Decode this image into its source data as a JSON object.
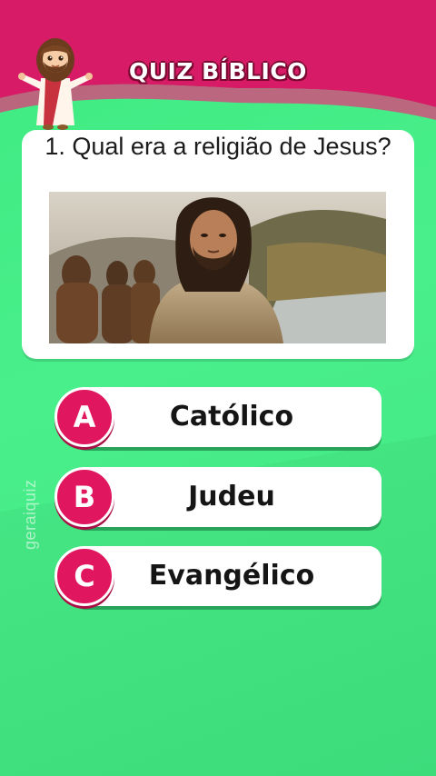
{
  "header": {
    "title": "QUIZ BÍBLICO",
    "mascot_icon": "jesus-mascot-icon",
    "background_color": "#d81b66",
    "wave_color": "#ee2f7c"
  },
  "question": {
    "text": "1. Qual era a religião de Jesus?",
    "image_icon": "jesus-portrait-image"
  },
  "answers": [
    {
      "letter": "A",
      "label": "Católico"
    },
    {
      "letter": "B",
      "label": "Judeu"
    },
    {
      "letter": "C",
      "label": "Evangélico"
    }
  ],
  "watermark": "geraiquiz",
  "colors": {
    "background": "#44ec86",
    "accent": "#e0175e",
    "card": "#ffffff"
  }
}
